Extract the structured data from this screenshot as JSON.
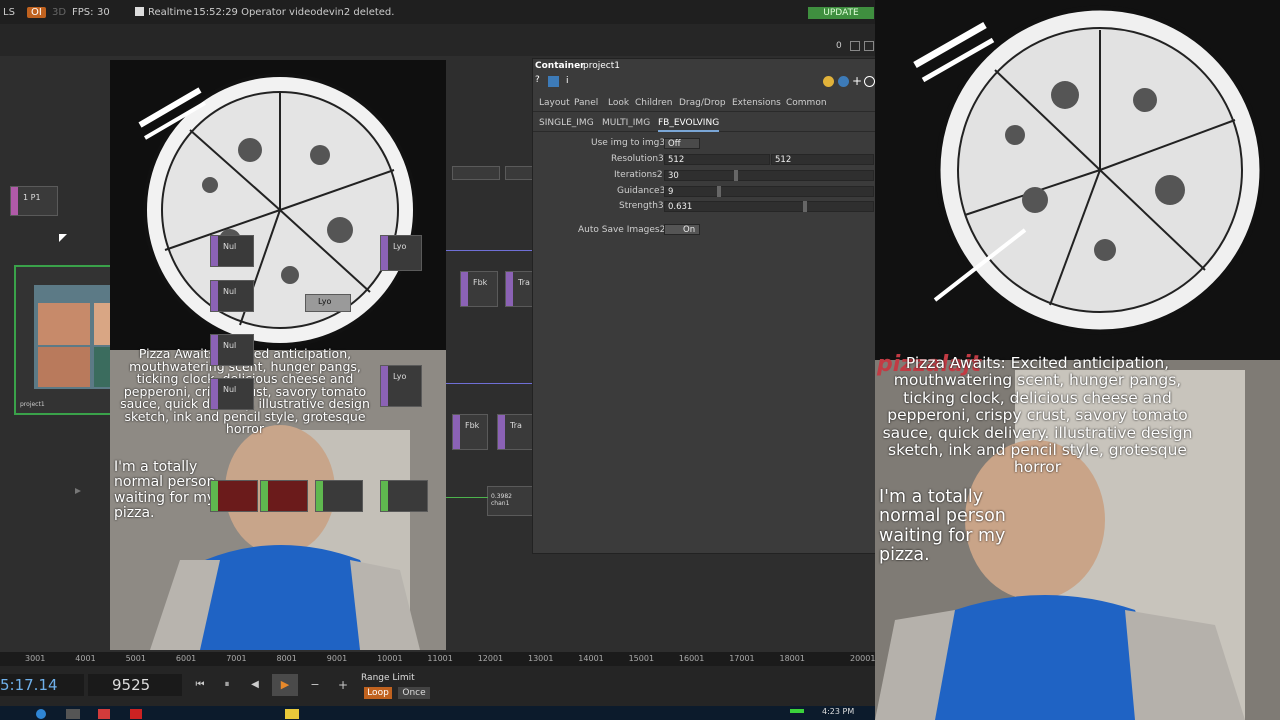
{
  "topbar": {
    "ls": "LS",
    "oi": "OI",
    "three_d": "3D",
    "fps_label": "FPS:",
    "fps_value": "30",
    "realtime": "Realtime",
    "status_msg": "15:52:29 Operator videodevin2 deleted.",
    "update": "UPDATE"
  },
  "window_controls": {
    "zero": "0"
  },
  "network": {
    "null_label": "Nul",
    "lyo_label": "Lyo",
    "fbk_label": "Fbk",
    "tra_label": "Tra",
    "p1_label": "1 P1",
    "value_node": "0.3982 chan1",
    "project_label": "project1"
  },
  "overlay_mid": {
    "caption": "Pizza Awaits: Excited anticipation, mouthwatering scent, hunger pangs, ticking clock, delicious cheese and pepperoni, crispy crust, savory tomato sauce, quick delivery.   illustrative design sketch, ink and pencil style, grotesque horror",
    "side_text": "I'm a totally normal person waiting for my pizza."
  },
  "panel": {
    "type": "Container",
    "name": "project1",
    "pages": [
      "Layout",
      "Panel",
      "Look",
      "Children",
      "Drag/Drop",
      "Extensions",
      "Common"
    ],
    "subtabs": [
      "SINGLE_IMG",
      "MULTI_IMG",
      "FB_EVOLVING"
    ],
    "active_subtab": "FB_EVOLVING",
    "params": {
      "use_img_label": "Use img to img3",
      "use_img_value": "Off",
      "resolution_label": "Resolution3",
      "resolution_a": "512",
      "resolution_b": "512",
      "iterations_label": "Iterations2",
      "iterations_value": "30",
      "guidance_label": "Guidance3",
      "guidance_value": "9",
      "strength_label": "Strength3",
      "strength_value": "0.631",
      "autosave_label": "Auto Save Images2",
      "autosave_value": "On"
    }
  },
  "timeline": {
    "ticks": [
      "3001",
      "4001",
      "5001",
      "6001",
      "7001",
      "8001",
      "9001",
      "10001",
      "11001",
      "12001",
      "13001",
      "14001",
      "15001",
      "16001",
      "17001",
      "18001",
      "20001"
    ]
  },
  "transport": {
    "timecode": "5:17.14",
    "frame": "9525",
    "range_limit": "Range Limit",
    "loop": "Loop",
    "once": "Once"
  },
  "taskbar": {
    "clock": "4:23 PM"
  },
  "right_overlay": {
    "watermark": "pizzalajt",
    "caption": "Pizza Awaits: Excited anticipation, mouthwatering scent, hunger pangs, ticking clock, delicious cheese and pepperoni, crispy crust, savory tomato sauce, quick delivery.   illustrative design sketch, ink and pencil style, grotesque horror",
    "side_text": "I'm a totally normal person waiting for my pizza."
  },
  "colors": {
    "accent_orange": "#c0621f",
    "update_green": "#3f8f3f",
    "operator_purple": "#8b62b5",
    "shirt_blue": "#1f63c4"
  }
}
